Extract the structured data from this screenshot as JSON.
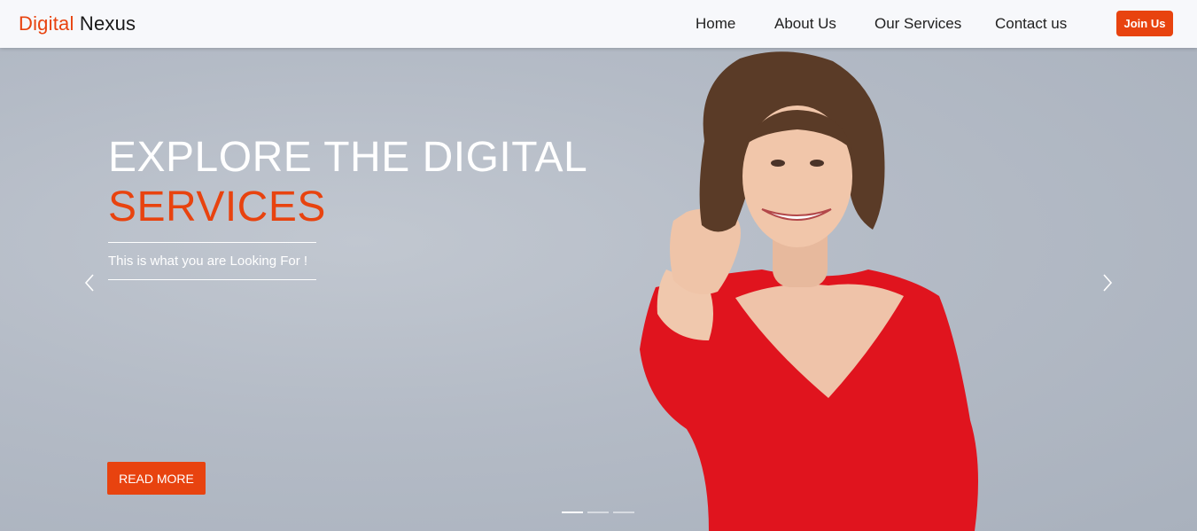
{
  "brand": {
    "part1": "Digital",
    "part2": "Nexus"
  },
  "nav": {
    "items": [
      {
        "label": "Home"
      },
      {
        "label": "About Us"
      },
      {
        "label": "Our Services"
      },
      {
        "label": "Contact us"
      }
    ],
    "join_label": "Join Us"
  },
  "hero": {
    "title_line1": "EXPLORE THE DIGITAL",
    "title_line2": "SERVICES",
    "tagline": "This is what you are Looking For !",
    "button_label": "READ MORE",
    "slide_count": 3,
    "active_slide": 1
  },
  "colors": {
    "accent": "#e8430f",
    "dress": "#e0141e"
  },
  "icons": {
    "prev": "chevron-left-icon",
    "next": "chevron-right-icon"
  }
}
